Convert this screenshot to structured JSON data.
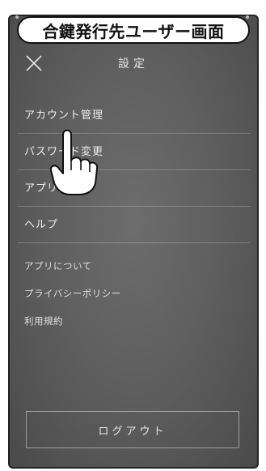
{
  "caption": "合鍵発行先ユーザー画面",
  "header": {
    "title": "設定",
    "close_icon": "close-icon"
  },
  "menu": {
    "items": [
      {
        "label": "アカウント管理"
      },
      {
        "label": "パスワード変更"
      },
      {
        "label": "アプリ設定"
      },
      {
        "label": "ヘルプ"
      }
    ]
  },
  "submenu": {
    "items": [
      {
        "label": "アプリについて"
      },
      {
        "label": "プライバシーポリシー"
      },
      {
        "label": "利用規約"
      }
    ]
  },
  "footer": {
    "logout_label": "ログアウト"
  },
  "pointer_icon": "pointing-hand-icon"
}
